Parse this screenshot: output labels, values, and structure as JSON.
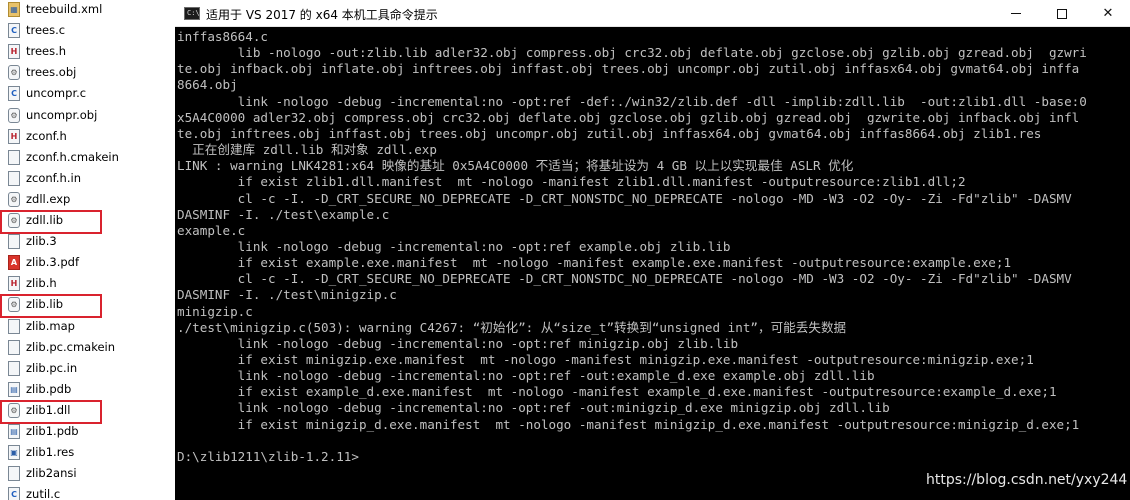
{
  "files": [
    {
      "name": "treebuild.xml",
      "icon": "xml-file-icon"
    },
    {
      "name": "trees.c",
      "icon": "c-file-icon"
    },
    {
      "name": "trees.h",
      "icon": "h-file-icon"
    },
    {
      "name": "trees.obj",
      "icon": "obj-file-icon"
    },
    {
      "name": "uncompr.c",
      "icon": "c-file-icon"
    },
    {
      "name": "uncompr.obj",
      "icon": "obj-file-icon"
    },
    {
      "name": "zconf.h",
      "icon": "h-file-icon"
    },
    {
      "name": "zconf.h.cmakein",
      "icon": "file-icon"
    },
    {
      "name": "zconf.h.in",
      "icon": "file-icon"
    },
    {
      "name": "zdll.exp",
      "icon": "exp-file-icon"
    },
    {
      "name": "zdll.lib",
      "icon": "lib-file-icon",
      "highlighted": true
    },
    {
      "name": "zlib.3",
      "icon": "file-icon"
    },
    {
      "name": "zlib.3.pdf",
      "icon": "pdf-file-icon"
    },
    {
      "name": "zlib.h",
      "icon": "h-file-icon"
    },
    {
      "name": "zlib.lib",
      "icon": "lib-file-icon",
      "highlighted": true
    },
    {
      "name": "zlib.map",
      "icon": "file-icon"
    },
    {
      "name": "zlib.pc.cmakein",
      "icon": "file-icon"
    },
    {
      "name": "zlib.pc.in",
      "icon": "file-icon"
    },
    {
      "name": "zlib.pdb",
      "icon": "pdb-file-icon"
    },
    {
      "name": "zlib1.dll",
      "icon": "dll-file-icon",
      "highlighted": true
    },
    {
      "name": "zlib1.pdb",
      "icon": "pdb-file-icon"
    },
    {
      "name": "zlib1.res",
      "icon": "res-file-icon"
    },
    {
      "name": "zlib2ansi",
      "icon": "file-icon"
    },
    {
      "name": "zutil.c",
      "icon": "c-file-icon"
    }
  ],
  "console": {
    "title": "适用于 VS 2017 的 x64 本机工具命令提示",
    "icon": "cmd-icon",
    "icon_text": "C:\\",
    "buttons": {
      "minimize": "minimize-icon",
      "maximize": "maximize-icon",
      "close_label": "✕"
    },
    "lines": [
      "inffas8664.c",
      "        lib -nologo -out:zlib.lib adler32.obj compress.obj crc32.obj deflate.obj gzclose.obj gzlib.obj gzread.obj  gzwri",
      "te.obj infback.obj inflate.obj inftrees.obj inffast.obj trees.obj uncompr.obj zutil.obj inffasx64.obj gvmat64.obj inffa",
      "8664.obj",
      "        link -nologo -debug -incremental:no -opt:ref -def:./win32/zlib.def -dll -implib:zdll.lib  -out:zlib1.dll -base:0",
      "x5A4C0000 adler32.obj compress.obj crc32.obj deflate.obj gzclose.obj gzlib.obj gzread.obj  gzwrite.obj infback.obj infl",
      "te.obj inftrees.obj inffast.obj trees.obj uncompr.obj zutil.obj inffasx64.obj gvmat64.obj inffas8664.obj zlib1.res",
      "  正在创建库 zdll.lib 和对象 zdll.exp",
      "LINK : warning LNK4281:x64 映像的基址 0x5A4C0000 不适当；将基址设为 4 GB 以上以实现最佳 ASLR 优化",
      "        if exist zlib1.dll.manifest  mt -nologo -manifest zlib1.dll.manifest -outputresource:zlib1.dll;2",
      "        cl -c -I. -D_CRT_SECURE_NO_DEPRECATE -D_CRT_NONSTDC_NO_DEPRECATE -nologo -MD -W3 -O2 -Oy- -Zi -Fd\"zlib\" -DASMV",
      "DASMINF -I. ./test\\example.c",
      "example.c",
      "        link -nologo -debug -incremental:no -opt:ref example.obj zlib.lib",
      "        if exist example.exe.manifest  mt -nologo -manifest example.exe.manifest -outputresource:example.exe;1",
      "        cl -c -I. -D_CRT_SECURE_NO_DEPRECATE -D_CRT_NONSTDC_NO_DEPRECATE -nologo -MD -W3 -O2 -Oy- -Zi -Fd\"zlib\" -DASMV",
      "DASMINF -I. ./test\\minigzip.c",
      "minigzip.c",
      "./test\\minigzip.c(503): warning C4267: “初始化”: 从“size_t”转换到“unsigned int”，可能丢失数据",
      "        link -nologo -debug -incremental:no -opt:ref minigzip.obj zlib.lib",
      "        if exist minigzip.exe.manifest  mt -nologo -manifest minigzip.exe.manifest -outputresource:minigzip.exe;1",
      "        link -nologo -debug -incremental:no -opt:ref -out:example_d.exe example.obj zdll.lib",
      "        if exist example_d.exe.manifest  mt -nologo -manifest example_d.exe.manifest -outputresource:example_d.exe;1",
      "        link -nologo -debug -incremental:no -opt:ref -out:minigzip_d.exe minigzip.obj zdll.lib",
      "        if exist minigzip_d.exe.manifest  mt -nologo -manifest minigzip_d.exe.manifest -outputresource:minigzip_d.exe;1",
      "",
      "D:\\zlib1211\\zlib-1.2.11>"
    ]
  },
  "watermark": "https://blog.csdn.net/yxy244",
  "colors": {
    "console_bg": "#000000",
    "console_text": "#c0c0c0",
    "highlight_box": "#d9232e"
  }
}
